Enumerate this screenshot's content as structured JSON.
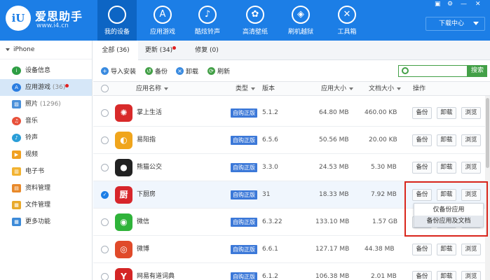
{
  "app": {
    "brand_name": "爱思助手",
    "brand_url": "www.i4.cn",
    "logo_glyph": "iU",
    "accent": "#1c7ee6"
  },
  "nav": [
    {
      "label": "我的设备",
      "icon": "apple-icon",
      "glyph": ""
    },
    {
      "label": "应用游戏",
      "icon": "app-store-icon",
      "glyph": "A"
    },
    {
      "label": "酷炫铃声",
      "icon": "bell-icon",
      "glyph": "♪"
    },
    {
      "label": "高清壁纸",
      "icon": "flower-icon",
      "glyph": "✿"
    },
    {
      "label": "刷机越狱",
      "icon": "dropbox-icon",
      "glyph": "◈"
    },
    {
      "label": "工具箱",
      "icon": "tools-icon",
      "glyph": "✕"
    }
  ],
  "window_controls": {
    "a": "▣",
    "b": "⚙",
    "c": "—",
    "d": "✕"
  },
  "download_center": "下载中心",
  "sidebar": {
    "device": "iPhone",
    "items": [
      {
        "label": "设备信息",
        "count": "",
        "icon": "info-icon",
        "color": "#2e9e44",
        "glyph": "i"
      },
      {
        "label": "应用游戏",
        "count": "(36)",
        "icon": "app-icon",
        "color": "#2a7de1",
        "glyph": "A"
      },
      {
        "label": "照片",
        "count": "(1296)",
        "icon": "photo-icon",
        "color": "#4a90d9",
        "glyph": "▨"
      },
      {
        "label": "音乐",
        "count": "",
        "icon": "music-icon",
        "color": "#e8503a",
        "glyph": "♫"
      },
      {
        "label": "铃声",
        "count": "",
        "icon": "bell-icon",
        "color": "#2a9ed8",
        "glyph": "♪"
      },
      {
        "label": "视频",
        "count": "",
        "icon": "video-icon",
        "color": "#f0a020",
        "glyph": "▶"
      },
      {
        "label": "电子书",
        "count": "",
        "icon": "book-icon",
        "color": "#f2b230",
        "glyph": "▥"
      },
      {
        "label": "资料管理",
        "count": "",
        "icon": "data-icon",
        "color": "#e8892a",
        "glyph": "▤"
      },
      {
        "label": "文件管理",
        "count": "",
        "icon": "folder-icon",
        "color": "#e8a92a",
        "glyph": "▦"
      },
      {
        "label": "更多功能",
        "count": "",
        "icon": "grid-icon",
        "color": "#3c8ad8",
        "glyph": "▦"
      }
    ]
  },
  "tabs": [
    {
      "label": "全部 (36)"
    },
    {
      "label": "更新 (34)"
    },
    {
      "label": "修复 (0)"
    }
  ],
  "toolbar": {
    "import": "导入安装",
    "backup": "备份",
    "uninstall": "卸载",
    "refresh": "刷新",
    "search_placeholder": "",
    "search_button": "搜索"
  },
  "table": {
    "headers": {
      "name": "应用名称",
      "type": "类型",
      "version": "版本",
      "app_size": "应用大小",
      "doc_size": "文档大小",
      "actions": "操作"
    },
    "rows": [
      {
        "name": "掌上生活",
        "type": "自购正版",
        "version": "5.1.2",
        "app_size": "64.80 MB",
        "doc_size": "460.00 KB",
        "icon_color": "#d82a2a",
        "glyph": "✺",
        "checked": false
      },
      {
        "name": "易阳指",
        "type": "自购正版",
        "version": "6.5.6",
        "app_size": "50.56 MB",
        "doc_size": "20.00 KB",
        "icon_color": "#f0a51c",
        "glyph": "◐",
        "checked": false
      },
      {
        "name": "熊猫公交",
        "type": "自购正版",
        "version": "3.3.0",
        "app_size": "24.53 MB",
        "doc_size": "5.30 MB",
        "icon_color": "#222222",
        "glyph": "●",
        "checked": false
      },
      {
        "name": "下厨房",
        "type": "自购正版",
        "version": "31",
        "app_size": "18.33 MB",
        "doc_size": "7.92 MB",
        "icon_color": "#d7262b",
        "glyph": "厨",
        "checked": true
      },
      {
        "name": "微信",
        "type": "自购正版",
        "version": "6.3.22",
        "app_size": "133.10 MB",
        "doc_size": "1.57 GB",
        "icon_color": "#2fb33a",
        "glyph": "◉",
        "checked": false
      },
      {
        "name": "微博",
        "type": "自购正版",
        "version": "6.6.1",
        "app_size": "127.17 MB",
        "doc_size": "44.38 MB",
        "icon_color": "#e04a2a",
        "glyph": "◎",
        "checked": false
      },
      {
        "name": "网易有道词典",
        "type": "自购正版",
        "version": "6.1.2",
        "app_size": "106.38 MB",
        "doc_size": "2.01 MB",
        "icon_color": "#d42525",
        "glyph": "Y",
        "checked": false
      }
    ],
    "actions": {
      "backup": "备份",
      "uninstall": "卸载",
      "browse": "浏览"
    }
  },
  "dropdown": {
    "items": [
      "仅备份应用",
      "备份应用及文档"
    ]
  }
}
